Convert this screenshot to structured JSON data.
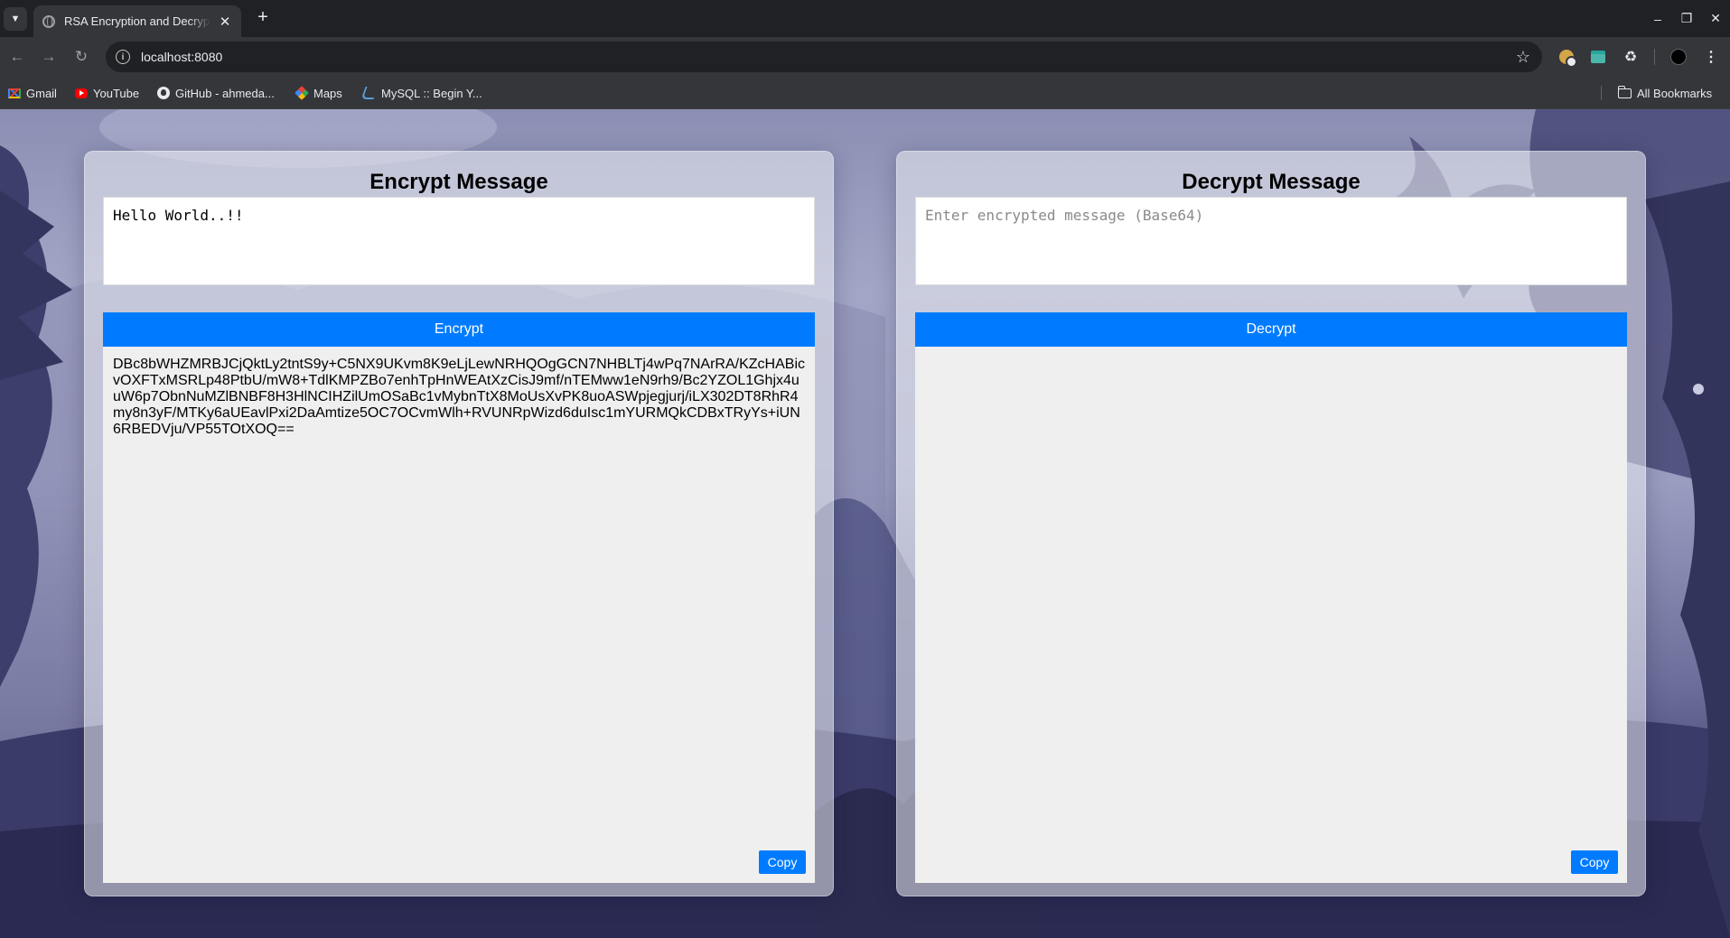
{
  "browser": {
    "tab_title": "RSA Encryption and Decryption",
    "url": "localhost:8080",
    "bookmarks": [
      {
        "label": "Gmail",
        "icon": "gmail-icon"
      },
      {
        "label": "YouTube",
        "icon": "youtube-icon"
      },
      {
        "label": "GitHub - ahmeda...",
        "icon": "github-icon"
      },
      {
        "label": "Maps",
        "icon": "maps-icon"
      },
      {
        "label": "MySQL :: Begin Y...",
        "icon": "mysql-icon"
      }
    ],
    "all_bookmarks_label": "All Bookmarks"
  },
  "encrypt": {
    "title": "Encrypt Message",
    "input_value": "Hello World..!!",
    "button_label": "Encrypt",
    "output": "DBc8bWHZMRBJCjQktLy2tntS9y+C5NX9UKvm8K9eLjLewNRHQOgGCN7NHBLTj4wPq7NArRA/KZcHABicvOXFTxMSRLp48PtbU/mW8+TdlKMPZBo7enhTpHnWEAtXzCisJ9mf/nTEMww1eN9rh9/Bc2YZOL1Ghjx4uuW6p7ObnNuMZlBNBF8H3HlNCIHZilUmOSaBc1vMybnTtX8MoUsXvPK8uoASWpjegjurj/iLX302DT8RhR4my8n3yF/MTKy6aUEavlPxi2DaAmtize5OC7OCvmWlh+RVUNRpWizd6duIsc1mYURMQkCDBxTRyYs+iUN6RBEDVju/VP55TOtXOQ==",
    "copy_label": "Copy"
  },
  "decrypt": {
    "title": "Decrypt Message",
    "input_placeholder": "Enter encrypted message (Base64)",
    "button_label": "Decrypt",
    "output": "",
    "copy_label": "Copy"
  },
  "theme": {
    "accent": "#007bff",
    "output_bg": "#efefef"
  }
}
